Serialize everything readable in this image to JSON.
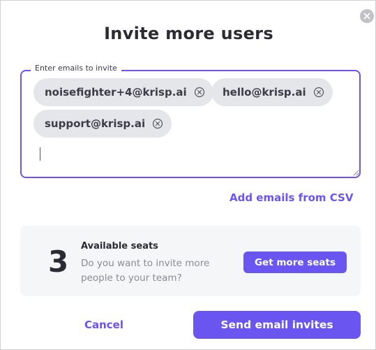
{
  "dialog": {
    "title": "Invite more users",
    "close_icon": "close-icon"
  },
  "emails": {
    "legend": "Enter emails to invite",
    "chips": [
      {
        "email": "noisefighter+4@krisp.ai",
        "remove_icon": "circle-x-icon"
      },
      {
        "email": "hello@krisp.ai",
        "remove_icon": "circle-x-icon"
      },
      {
        "email": "support@krisp.ai",
        "remove_icon": "circle-x-icon"
      }
    ],
    "input_value": ""
  },
  "csv_link_label": "Add emails from CSV",
  "seats": {
    "count": "3",
    "title": "Available seats",
    "description": "Do you want to invite more people to your team?",
    "button_label": "Get more seats"
  },
  "footer": {
    "cancel_label": "Cancel",
    "send_label": "Send email invites"
  },
  "colors": {
    "accent": "#6b55f0",
    "chip_bg": "#e5e6ea",
    "card_bg": "#f5f6f8",
    "text_dark": "#2b2b33",
    "text_muted": "#8a8a94"
  }
}
